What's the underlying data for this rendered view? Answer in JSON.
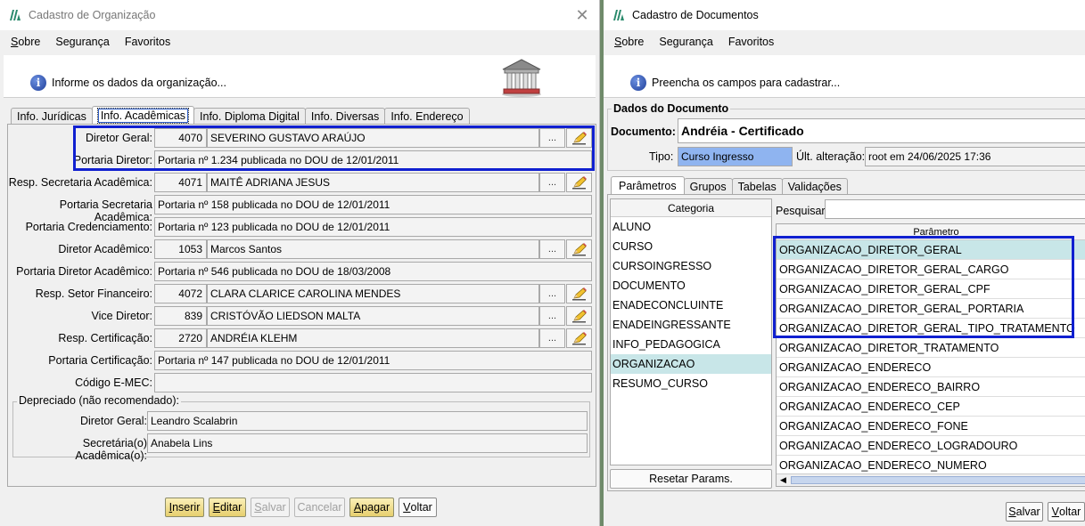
{
  "left_window": {
    "title": "Cadastro de Organização",
    "menu": [
      "Sobre",
      "Segurança",
      "Favoritos"
    ],
    "banner_message": "Informe os dados da organização...",
    "tabs": [
      "Info. Jurídicas",
      "Info. Acadêmicas",
      "Info. Diploma Digital",
      "Info. Diversas",
      "Info. Endereço"
    ],
    "fields": [
      {
        "label": "Diretor Geral:",
        "code": "4070",
        "value": "SEVERINO GUSTAVO ARAÚJO",
        "lookup": true
      },
      {
        "label": "Portaria Diretor:",
        "value": "Portaria nº 1.234 publicada no DOU de 12/01/2011"
      },
      {
        "label": "Resp. Secretaria Acadêmica:",
        "code": "4071",
        "value": "MAITÊ ADRIANA JESUS",
        "lookup": true
      },
      {
        "label": "Portaria Secretaria Acadêmica:",
        "value": "Portaria nº 158 publicada no DOU de 12/01/2011"
      },
      {
        "label": "Portaria Credenciamento:",
        "value": "Portaria nº 123 publicada no DOU de 12/01/2011"
      },
      {
        "label": "Diretor Acadêmico:",
        "code": "1053",
        "value": "Marcos Santos",
        "lookup": true
      },
      {
        "label": "Portaria Diretor Acadêmico:",
        "value": "Portaria nº 546 publicada no DOU de 18/03/2008"
      },
      {
        "label": "Resp. Setor Financeiro:",
        "code": "4072",
        "value": "CLARA CLARICE CAROLINA MENDES",
        "lookup": true
      },
      {
        "label": "Vice Diretor:",
        "code": "839",
        "value": "CRISTÓVÃO LIEDSON MALTA",
        "lookup": true
      },
      {
        "label": "Resp. Certificação:",
        "code": "2720",
        "value": "ANDRÉIA KLEHM",
        "lookup": true
      },
      {
        "label": "Portaria Certificação:",
        "value": "Portaria nº 147 publicada no DOU de 12/01/2011"
      },
      {
        "label": "Código E-MEC:",
        "value": ""
      }
    ],
    "lookup_button_label": "...",
    "deprecated": {
      "title": "Depreciado (não recomendado):",
      "fields": [
        {
          "label": "Diretor Geral:",
          "value": "Leandro Scalabrin"
        },
        {
          "label": "Secretária(o) Acadêmica(o):",
          "value": "Anabela Lins"
        }
      ]
    },
    "buttons": [
      {
        "label": "Inserir",
        "style": "yellow"
      },
      {
        "label": "Editar",
        "style": "yellow"
      },
      {
        "label": "Salvar",
        "style": "disabled"
      },
      {
        "label": "Cancelar",
        "style": "disabled"
      },
      {
        "label": "Apagar",
        "style": "yellow"
      },
      {
        "label": "Voltar",
        "style": "plain"
      }
    ]
  },
  "right_window": {
    "title": "Cadastro de Documentos",
    "menu": [
      "Sobre",
      "Segurança",
      "Favoritos"
    ],
    "banner_message": "Preencha os campos para cadastrar...",
    "section_title": "Dados do Documento",
    "document_label": "Documento:",
    "document_value": "Andréia - Certificado",
    "tipo_label": "Tipo:",
    "tipo_value": "Curso Ingresso",
    "ult_alteracao_label": "Últ. alteração:",
    "ult_alteracao_value": "root em 24/06/2025 17:36",
    "tabs": [
      "Parâmetros",
      "Grupos",
      "Tabelas",
      "Validações"
    ],
    "categoria_header": "Categoria",
    "categorias": [
      "ALUNO",
      "CURSO",
      "CURSOINGRESSO",
      "DOCUMENTO",
      "ENADECONCLUINTE",
      "ENADEINGRESSANTE",
      "INFO_PEDAGOGICA",
      "ORGANIZACAO",
      "RESUMO_CURSO"
    ],
    "selected_categoria": "ORGANIZACAO",
    "reset_button": "Resetar Params.",
    "search_label": "Pesquisar:",
    "search_value": "",
    "parametro_header": "Parâmetro",
    "parametros": [
      "ORGANIZACAO_DIRETOR_GERAL",
      "ORGANIZACAO_DIRETOR_GERAL_CARGO",
      "ORGANIZACAO_DIRETOR_GERAL_CPF",
      "ORGANIZACAO_DIRETOR_GERAL_PORTARIA",
      "ORGANIZACAO_DIRETOR_GERAL_TIPO_TRATAMENTO",
      "ORGANIZACAO_DIRETOR_TRATAMENTO",
      "ORGANIZACAO_ENDERECO",
      "ORGANIZACAO_ENDERECO_BAIRRO",
      "ORGANIZACAO_ENDERECO_CEP",
      "ORGANIZACAO_ENDERECO_FONE",
      "ORGANIZACAO_ENDERECO_LOGRADOURO",
      "ORGANIZACAO_ENDERECO_NUMERO"
    ],
    "selected_parametro": "ORGANIZACAO_DIRETOR_GERAL",
    "buttons": [
      "Salvar",
      "Voltar"
    ]
  },
  "colors": {
    "highlight": "#1020d0",
    "selection": "#c8e6e8",
    "tipo_field": "#8fb4f0",
    "button_yellow": "#e7cf6e"
  }
}
